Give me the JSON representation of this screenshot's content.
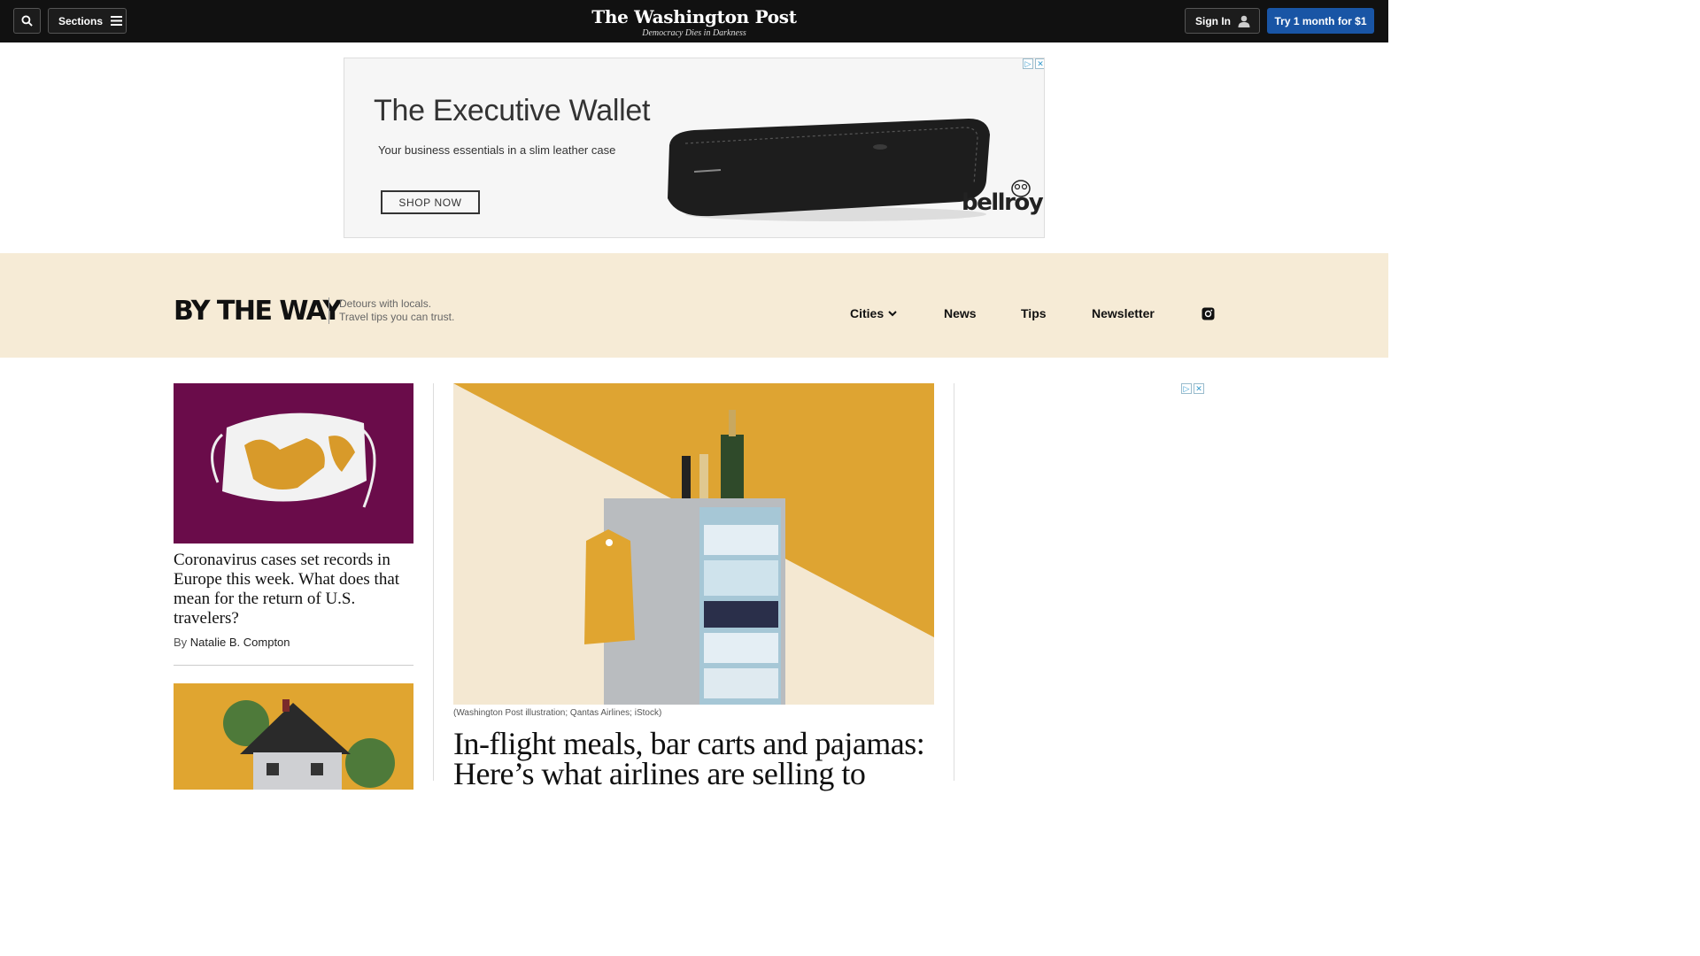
{
  "topbar": {
    "sections_label": "Sections",
    "masthead_title": "The Washington Post",
    "masthead_tagline": "Democracy Dies in Darkness",
    "signin_label": "Sign In",
    "subscribe_label": "Try 1 month for $1"
  },
  "ad_top": {
    "title": "The Executive Wallet",
    "subtitle": "Your business essentials in a slim leather case",
    "cta": "SHOP NOW",
    "brand": "bellroy"
  },
  "section": {
    "logo": "BY THE WAY",
    "tagline_line1": "Detours with locals.",
    "tagline_line2": "Travel tips you can trust.",
    "nav": [
      "Cities",
      "News",
      "Tips",
      "Newsletter"
    ]
  },
  "left_story": {
    "headline": "Coronavirus cases set records in Europe this week. What does that mean for the return of U.S. travelers?",
    "by_prefix": "By",
    "author": "Natalie B. Compton"
  },
  "main_story": {
    "caption": "(Washington Post illustration; Qantas Airlines; iStock)",
    "headline": "In-flight meals, bar carts and pajamas: Here’s what airlines are selling to"
  },
  "colors": {
    "topbar": "#111111",
    "subscribe": "#1955a5",
    "band": "#f6ebd6",
    "mask_bg": "#6a0c4a",
    "mustard": "#e0a530"
  }
}
